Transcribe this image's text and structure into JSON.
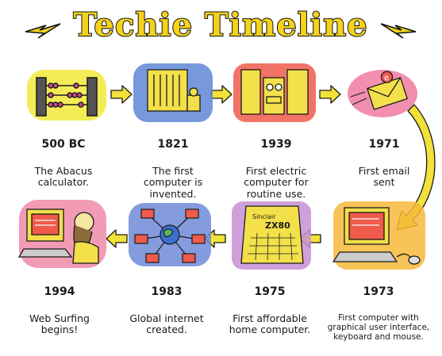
{
  "title": "Techie Timeline",
  "colors": {
    "title_fill": "#f5d21c",
    "arrow": "#f2e13a",
    "outline": "#1a1a1a"
  },
  "events": [
    {
      "year": "500 BC",
      "text": "The Abacus\ncalculator.",
      "icon": "abacus-icon",
      "wash": "#f3ea45"
    },
    {
      "year": "1821",
      "text": "The first\ncomputer is\ninvented.",
      "icon": "difference-engine-icon",
      "wash": "#5f86d6"
    },
    {
      "year": "1939",
      "text": "First electric\ncomputer for\nroutine use.",
      "icon": "electric-computer-icon",
      "wash": "#ef5a4a"
    },
    {
      "year": "1971",
      "text": "First email\nsent",
      "icon": "envelope-icon",
      "wash": "#f07aa0"
    },
    {
      "year": "1973",
      "text": "First computer with\ngraphical user interface,\nkeyboard and mouse.",
      "icon": "gui-computer-icon",
      "wash": "#f7b83a"
    },
    {
      "year": "1975",
      "text": "First affordable\nhome computer.",
      "icon": "home-computer-icon",
      "wash": "#c88fd6",
      "device_label": "Sinclair\nZX80"
    },
    {
      "year": "1983",
      "text": "Global internet\ncreated.",
      "icon": "globe-network-icon",
      "wash": "#6f8ad8"
    },
    {
      "year": "1994",
      "text": "Web Surfing\nbegins!",
      "icon": "web-surfer-icon",
      "wash": "#f08aa8"
    }
  ]
}
